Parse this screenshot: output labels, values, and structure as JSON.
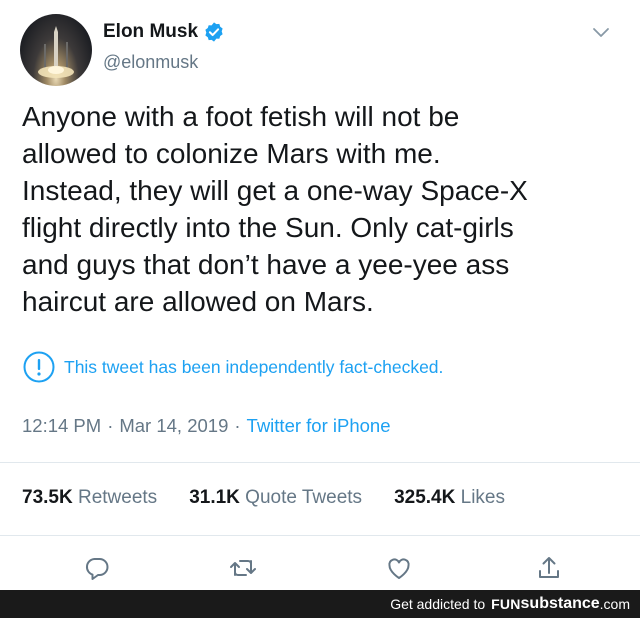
{
  "author": {
    "name": "Elon Musk",
    "handle": "@elonmusk",
    "verified_icon": "verified-badge-icon",
    "avatar_icon": "rocket-launch-avatar"
  },
  "tweet": {
    "text": "Anyone with a foot fetish will not be\nallowed to colonize Mars with me.\nInstead, they will get a one-way Space-X\nflight directly into the Sun. Only cat-girls\nand guys that don’t have a yee-yee ass\nhaircut are allowed on Mars.",
    "fact_check": "This tweet has been independently fact-checked.",
    "time": "12:14 PM",
    "separator": "·",
    "date": "Mar 14, 2019",
    "source": "Twitter for iPhone"
  },
  "stats": [
    {
      "num": "73.5K",
      "label": "Retweets"
    },
    {
      "num": "31.1K",
      "label": "Quote Tweets"
    },
    {
      "num": "325.4K",
      "label": "Likes"
    }
  ],
  "actions": [
    "reply-icon",
    "retweet-icon",
    "like-icon",
    "share-icon"
  ],
  "footer": {
    "text": "Get addicted to",
    "brand_fun": "FUN",
    "brand_sub": "substance",
    "brand_com": ".com"
  },
  "colors": {
    "link": "#1da1f2",
    "secondary": "#657786",
    "primary": "#14171a",
    "divider": "#e1e8ed",
    "footer_bg": "#1a1a1a"
  }
}
